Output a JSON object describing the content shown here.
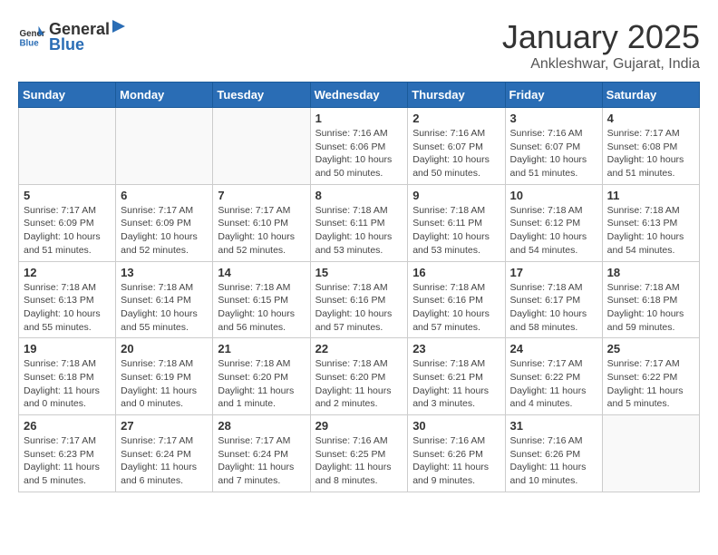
{
  "header": {
    "logo_general": "General",
    "logo_blue": "Blue",
    "month_title": "January 2025",
    "subtitle": "Ankleshwar, Gujarat, India"
  },
  "weekdays": [
    "Sunday",
    "Monday",
    "Tuesday",
    "Wednesday",
    "Thursday",
    "Friday",
    "Saturday"
  ],
  "weeks": [
    [
      {
        "day": "",
        "info": ""
      },
      {
        "day": "",
        "info": ""
      },
      {
        "day": "",
        "info": ""
      },
      {
        "day": "1",
        "info": "Sunrise: 7:16 AM\nSunset: 6:06 PM\nDaylight: 10 hours\nand 50 minutes."
      },
      {
        "day": "2",
        "info": "Sunrise: 7:16 AM\nSunset: 6:07 PM\nDaylight: 10 hours\nand 50 minutes."
      },
      {
        "day": "3",
        "info": "Sunrise: 7:16 AM\nSunset: 6:07 PM\nDaylight: 10 hours\nand 51 minutes."
      },
      {
        "day": "4",
        "info": "Sunrise: 7:17 AM\nSunset: 6:08 PM\nDaylight: 10 hours\nand 51 minutes."
      }
    ],
    [
      {
        "day": "5",
        "info": "Sunrise: 7:17 AM\nSunset: 6:09 PM\nDaylight: 10 hours\nand 51 minutes."
      },
      {
        "day": "6",
        "info": "Sunrise: 7:17 AM\nSunset: 6:09 PM\nDaylight: 10 hours\nand 52 minutes."
      },
      {
        "day": "7",
        "info": "Sunrise: 7:17 AM\nSunset: 6:10 PM\nDaylight: 10 hours\nand 52 minutes."
      },
      {
        "day": "8",
        "info": "Sunrise: 7:18 AM\nSunset: 6:11 PM\nDaylight: 10 hours\nand 53 minutes."
      },
      {
        "day": "9",
        "info": "Sunrise: 7:18 AM\nSunset: 6:11 PM\nDaylight: 10 hours\nand 53 minutes."
      },
      {
        "day": "10",
        "info": "Sunrise: 7:18 AM\nSunset: 6:12 PM\nDaylight: 10 hours\nand 54 minutes."
      },
      {
        "day": "11",
        "info": "Sunrise: 7:18 AM\nSunset: 6:13 PM\nDaylight: 10 hours\nand 54 minutes."
      }
    ],
    [
      {
        "day": "12",
        "info": "Sunrise: 7:18 AM\nSunset: 6:13 PM\nDaylight: 10 hours\nand 55 minutes."
      },
      {
        "day": "13",
        "info": "Sunrise: 7:18 AM\nSunset: 6:14 PM\nDaylight: 10 hours\nand 55 minutes."
      },
      {
        "day": "14",
        "info": "Sunrise: 7:18 AM\nSunset: 6:15 PM\nDaylight: 10 hours\nand 56 minutes."
      },
      {
        "day": "15",
        "info": "Sunrise: 7:18 AM\nSunset: 6:16 PM\nDaylight: 10 hours\nand 57 minutes."
      },
      {
        "day": "16",
        "info": "Sunrise: 7:18 AM\nSunset: 6:16 PM\nDaylight: 10 hours\nand 57 minutes."
      },
      {
        "day": "17",
        "info": "Sunrise: 7:18 AM\nSunset: 6:17 PM\nDaylight: 10 hours\nand 58 minutes."
      },
      {
        "day": "18",
        "info": "Sunrise: 7:18 AM\nSunset: 6:18 PM\nDaylight: 10 hours\nand 59 minutes."
      }
    ],
    [
      {
        "day": "19",
        "info": "Sunrise: 7:18 AM\nSunset: 6:18 PM\nDaylight: 11 hours\nand 0 minutes."
      },
      {
        "day": "20",
        "info": "Sunrise: 7:18 AM\nSunset: 6:19 PM\nDaylight: 11 hours\nand 0 minutes."
      },
      {
        "day": "21",
        "info": "Sunrise: 7:18 AM\nSunset: 6:20 PM\nDaylight: 11 hours\nand 1 minute."
      },
      {
        "day": "22",
        "info": "Sunrise: 7:18 AM\nSunset: 6:20 PM\nDaylight: 11 hours\nand 2 minutes."
      },
      {
        "day": "23",
        "info": "Sunrise: 7:18 AM\nSunset: 6:21 PM\nDaylight: 11 hours\nand 3 minutes."
      },
      {
        "day": "24",
        "info": "Sunrise: 7:17 AM\nSunset: 6:22 PM\nDaylight: 11 hours\nand 4 minutes."
      },
      {
        "day": "25",
        "info": "Sunrise: 7:17 AM\nSunset: 6:22 PM\nDaylight: 11 hours\nand 5 minutes."
      }
    ],
    [
      {
        "day": "26",
        "info": "Sunrise: 7:17 AM\nSunset: 6:23 PM\nDaylight: 11 hours\nand 5 minutes."
      },
      {
        "day": "27",
        "info": "Sunrise: 7:17 AM\nSunset: 6:24 PM\nDaylight: 11 hours\nand 6 minutes."
      },
      {
        "day": "28",
        "info": "Sunrise: 7:17 AM\nSunset: 6:24 PM\nDaylight: 11 hours\nand 7 minutes."
      },
      {
        "day": "29",
        "info": "Sunrise: 7:16 AM\nSunset: 6:25 PM\nDaylight: 11 hours\nand 8 minutes."
      },
      {
        "day": "30",
        "info": "Sunrise: 7:16 AM\nSunset: 6:26 PM\nDaylight: 11 hours\nand 9 minutes."
      },
      {
        "day": "31",
        "info": "Sunrise: 7:16 AM\nSunset: 6:26 PM\nDaylight: 11 hours\nand 10 minutes."
      },
      {
        "day": "",
        "info": ""
      }
    ]
  ]
}
